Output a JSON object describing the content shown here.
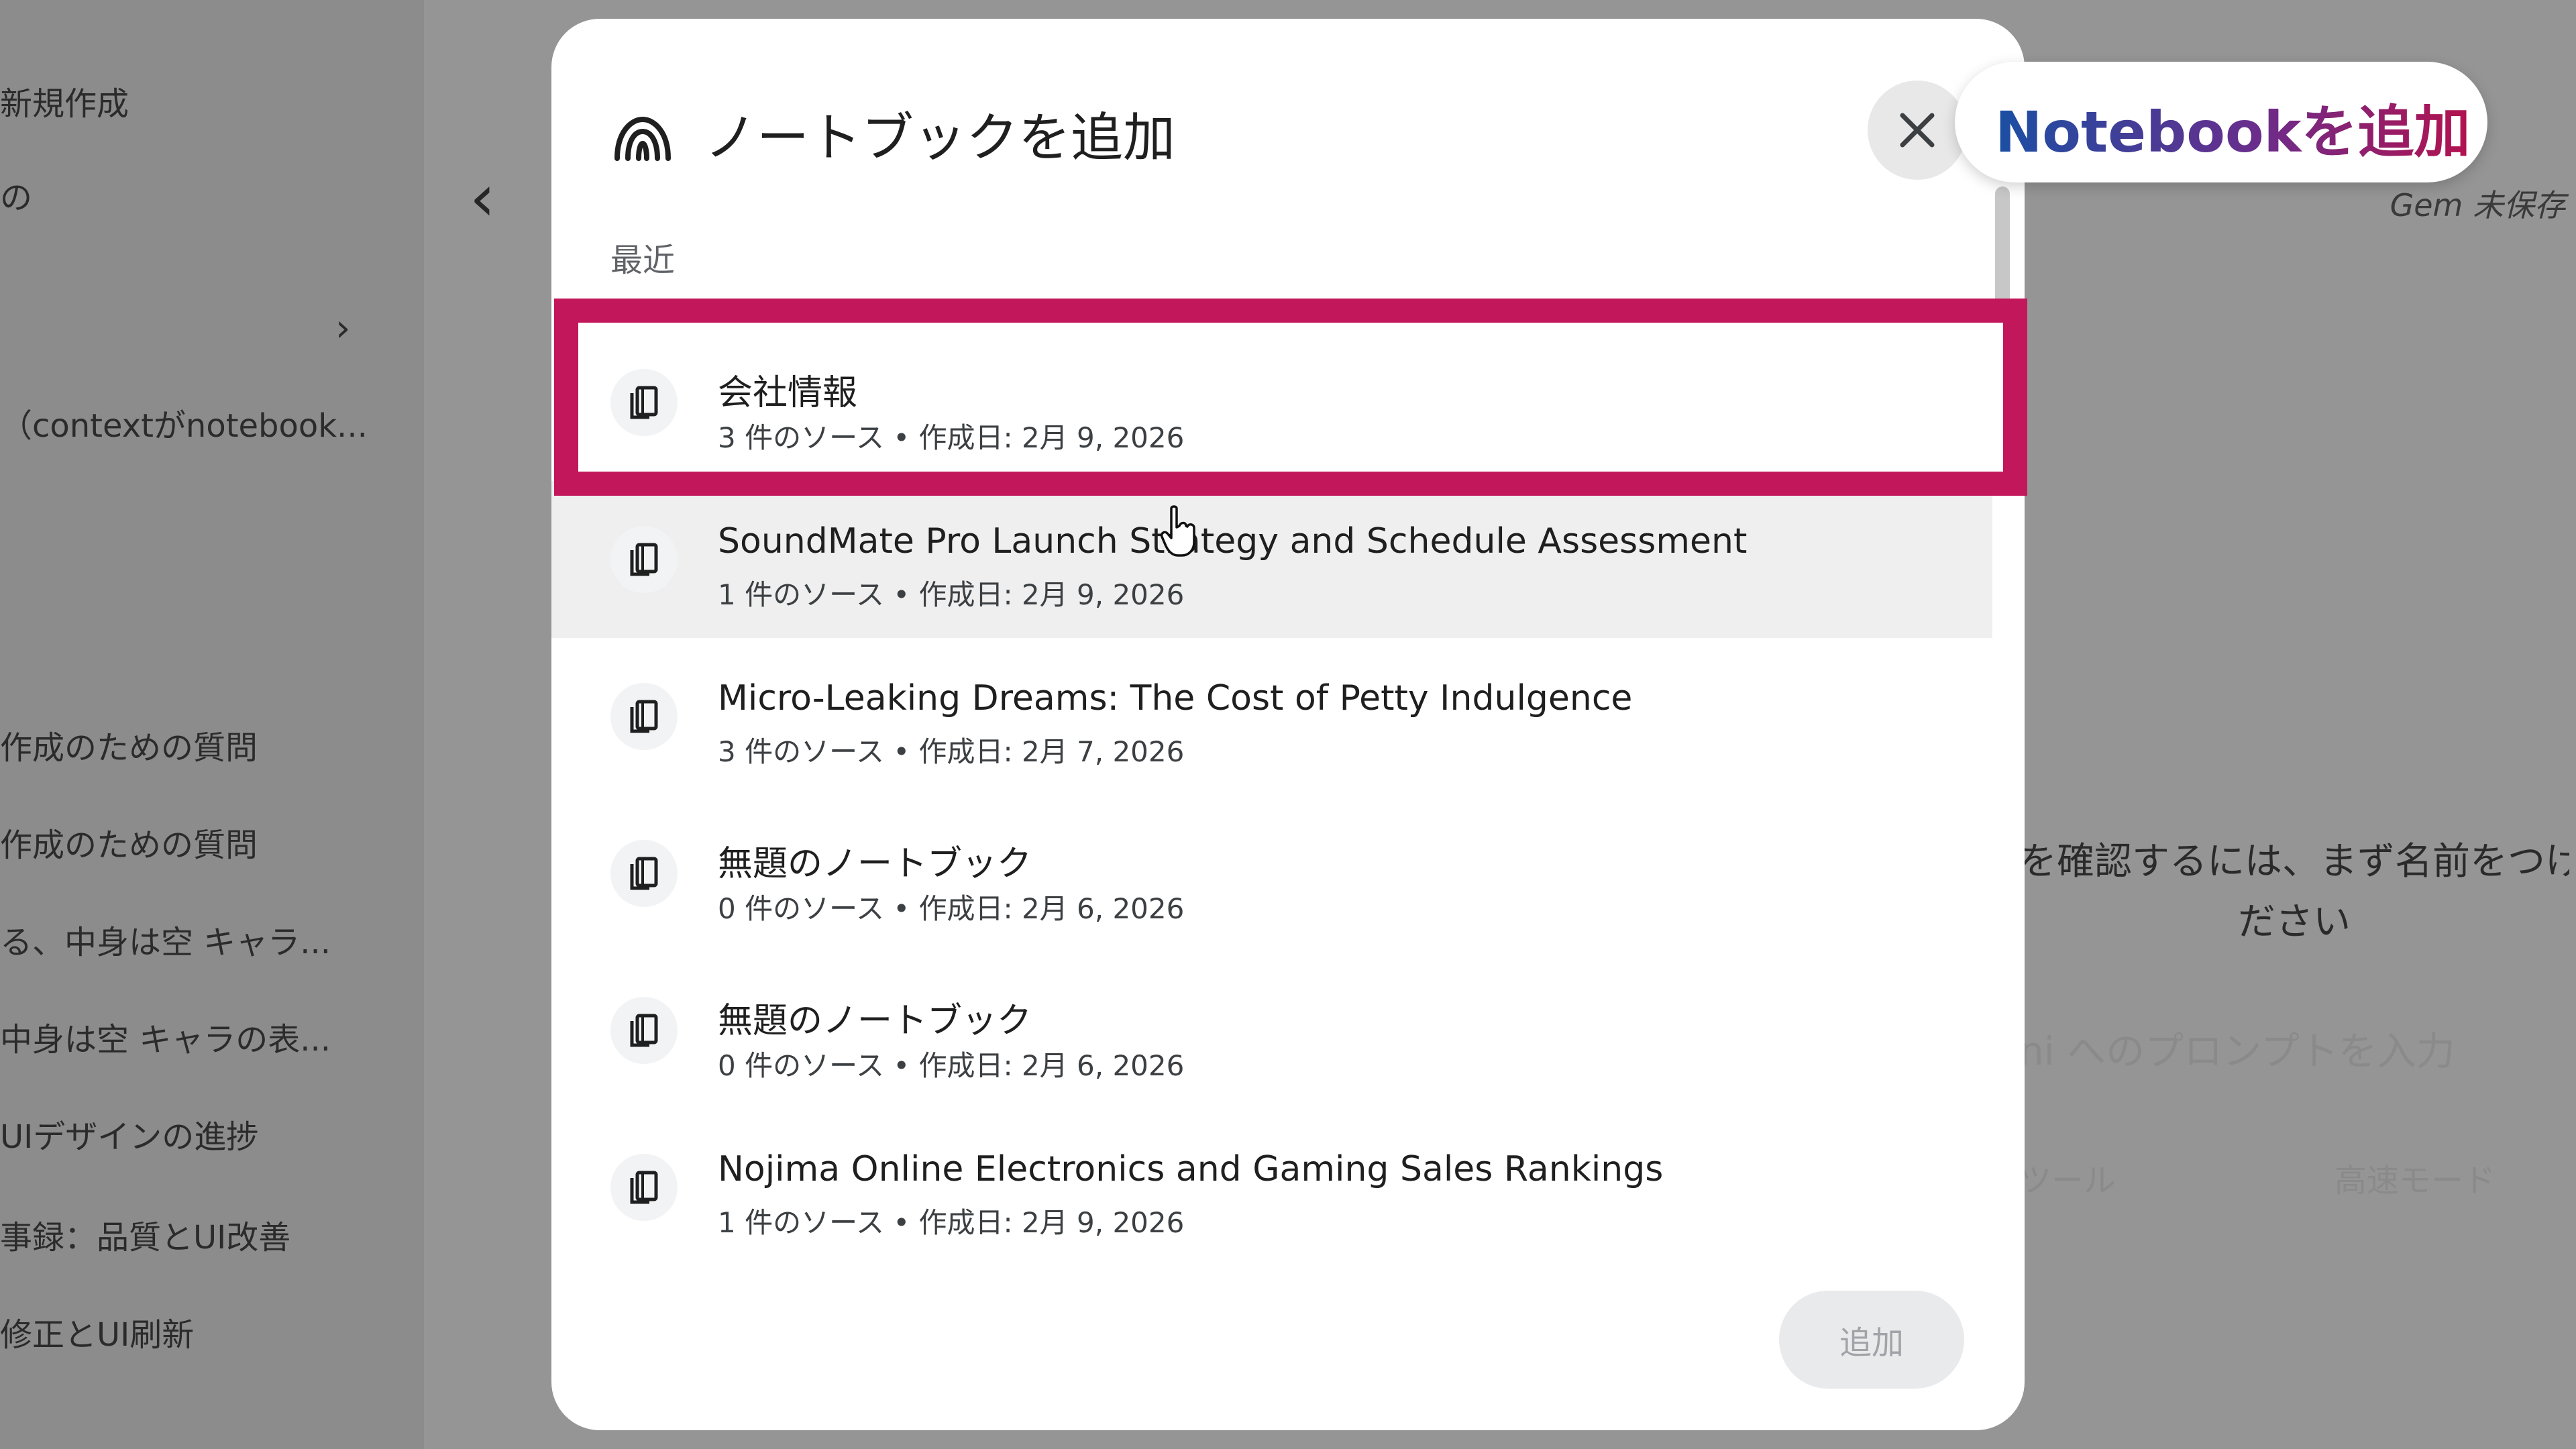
{
  "sidebar": {
    "items": [
      {
        "label": "新規作成"
      },
      {
        "label": "の"
      },
      {
        "label": "（contextがnotebook..."
      },
      {
        "label": "作成のための質問"
      },
      {
        "label": "作成のための質問"
      },
      {
        "label": "る、中身は空 キャラ..."
      },
      {
        "label": "中身は空 キャラの表..."
      },
      {
        "label": "UIデザインの進捗"
      },
      {
        "label": "事録：品質とUI改善"
      },
      {
        "label": "修正とUI刷新"
      }
    ],
    "chevron": "›"
  },
  "background": {
    "back_arrow": "‹",
    "gem_status": "Gem 未保存",
    "hint_line1": "を確認するには、まず名前をつけ",
    "hint_line2": "ださい",
    "prompt_placeholder": "ni へのプロンプトを入力",
    "tools_label": "ツール",
    "mode_label": "高速モード"
  },
  "modal": {
    "title": "ノートブックを追加",
    "section_label": "最近",
    "add_button": "追加",
    "notebooks": [
      {
        "title": "会社情報",
        "meta": "3 件のソース • 作成日: 2月 9, 2026"
      },
      {
        "title": "SoundMate Pro Launch Strategy and Schedule Assessment",
        "meta": "1 件のソース • 作成日: 2月 9, 2026"
      },
      {
        "title": "Micro-Leaking Dreams: The Cost of Petty Indulgence",
        "meta": "3 件のソース • 作成日: 2月 7, 2026"
      },
      {
        "title": "無題のノートブック",
        "meta": "0 件のソース • 作成日: 2月 6, 2026"
      },
      {
        "title": "無題のノートブック",
        "meta": "0 件のソース • 作成日: 2月 6, 2026"
      },
      {
        "title": "Nojima Online Electronics and Gaming Sales Rankings",
        "meta": "1 件のソース • 作成日: 2月 9, 2026"
      }
    ]
  },
  "callout": {
    "text": "Notebookを追加"
  },
  "colors": {
    "highlight": "#c2185b",
    "callout_gradient_start": "#1a4fa3",
    "callout_gradient_end": "#b3124f"
  }
}
